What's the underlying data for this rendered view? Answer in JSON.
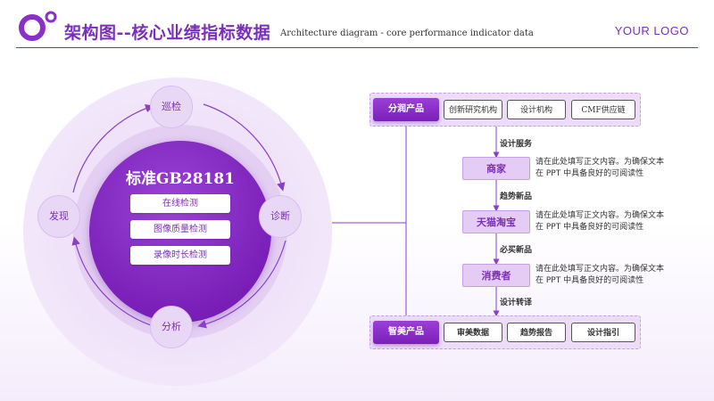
{
  "header": {
    "title": "架构图--核心业绩指标数据",
    "subtitle": "Architecture diagram - core performance indicator data",
    "brand": "YOUR LOGO",
    "accent": "#7a2fb8"
  },
  "cycle": {
    "core_title": "标准GB28181",
    "core_items": [
      "在线检测",
      "图像质量检测",
      "录像时长检测"
    ],
    "nodes": {
      "top": "巡检",
      "right": "诊断",
      "bottom": "分析",
      "left": "发现"
    }
  },
  "flow": {
    "top_main": "分润产品",
    "top_subs": [
      "创新研究机构",
      "设计机构",
      "CMF供应链"
    ],
    "steps": [
      {
        "label": "商家",
        "desc": "请在此处填写正文内容。为确保文本在 PPT 中具备良好的可阅读性"
      },
      {
        "label": "天猫淘宝",
        "desc": "请在此处填写正文内容。为确保文本在 PPT 中具备良好的可阅读性"
      },
      {
        "label": "消费者",
        "desc": "请在此处填写正文内容。为确保文本在 PPT 中具备良好的可阅读性"
      }
    ],
    "arrow_labels": [
      "设计服务",
      "趋势新品",
      "必买新品",
      "设计转译"
    ],
    "bottom_main": "智美产品",
    "bottom_subs": [
      "审美数据",
      "趋势报告",
      "设计指引"
    ]
  }
}
